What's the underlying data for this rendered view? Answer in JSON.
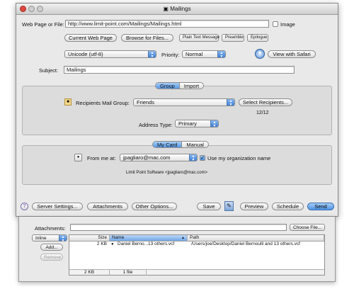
{
  "window": {
    "title": "Mailings"
  },
  "form": {
    "webpage_label": "Web Page or File:",
    "webpage_value": "http://www.limit-point.com/Mailings/Mailings.html",
    "image_checkbox_label": "Image",
    "current_page_button": "Current Web Page",
    "browse_button": "Browse for Files...",
    "plain_text_button": "Plain Text Message",
    "preamble_button": "Preamble",
    "epilogue_button": "Epilogue",
    "encoding_value": "Unicode (utf-8)",
    "priority_label": "Priority:",
    "priority_value": "Normal",
    "safari_button": "View with Safari",
    "subject_label": "Subject:",
    "subject_value": "Mailings"
  },
  "tabs_top": {
    "group": "Group",
    "import": "Import"
  },
  "group": {
    "recipients_label": "Recipients Mail Group:",
    "recipients_value": "Friends",
    "select_button": "Select Recipients...",
    "count": "12/12",
    "address_type_label": "Address Type:",
    "address_type_value": "Primary"
  },
  "tabs_card": {
    "my_card": "My Card",
    "manual": "Manual"
  },
  "card": {
    "from_label": "From me at:",
    "from_value": "jpagliaro@mac.com",
    "use_org_label": "Use my organization name",
    "signature": "Limit Point Software <jpagliaro@mac.com>"
  },
  "bottom": {
    "help": "?",
    "server_settings": "Server Settings...",
    "attachments": "Attachments",
    "other_options": "Other Options...",
    "save": "Save",
    "preview": "Preview",
    "schedule": "Schedule",
    "send": "Send"
  },
  "drawer": {
    "attachments_label": "Attachments:",
    "choose_file": "Choose File...",
    "disposition_value": "Inline",
    "add_button": "Add...",
    "remove_button": "Remove",
    "columns": [
      "Size",
      "Name",
      "Path"
    ],
    "rows": [
      {
        "size": "2 KB",
        "name": "Daniel Berno...13 others.vcf",
        "path": "/Users/joe/Desktop/Daniel Bernoulli and 13 others.vcf"
      }
    ],
    "footer_size": "2 KB",
    "footer_count": "1 file"
  },
  "colors": {
    "accent": "#5799e6",
    "window_bg": "#e9e9e9"
  }
}
